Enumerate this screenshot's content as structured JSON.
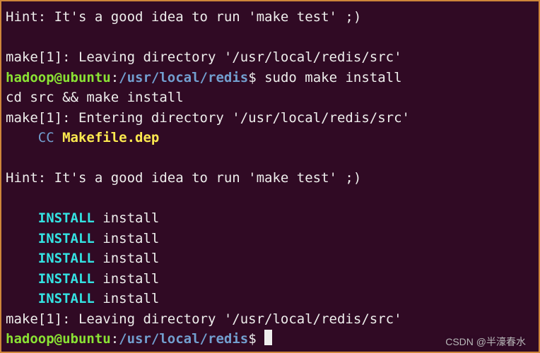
{
  "lines": {
    "hint1": "Hint: It's a good idea to run 'make test' ;)",
    "blank1": "",
    "leaving1": "make[1]: Leaving directory '/usr/local/redis/src'",
    "prompt1_user": "hadoop@ubuntu",
    "prompt1_colon": ":",
    "prompt1_path": "/usr/local/redis",
    "prompt1_dollar": "$ ",
    "cmd1": "sudo make install",
    "cdsrc": "cd src && make install",
    "entering": "make[1]: Entering directory '/usr/local/redis/src'",
    "cc_indent": "    ",
    "cc_label": "CC ",
    "cc_file": "Makefile.dep",
    "blank2": "",
    "hint2": "Hint: It's a good idea to run 'make test' ;)",
    "blank3": "",
    "install_indent": "    ",
    "install_label": "INSTALL ",
    "install_target": "install",
    "leaving2": "make[1]: Leaving directory '/usr/local/redis/src'",
    "prompt2_user": "hadoop@ubuntu",
    "prompt2_colon": ":",
    "prompt2_path": "/usr/local/redis",
    "prompt2_dollar": "$ "
  },
  "watermark": "CSDN @半濠春水"
}
